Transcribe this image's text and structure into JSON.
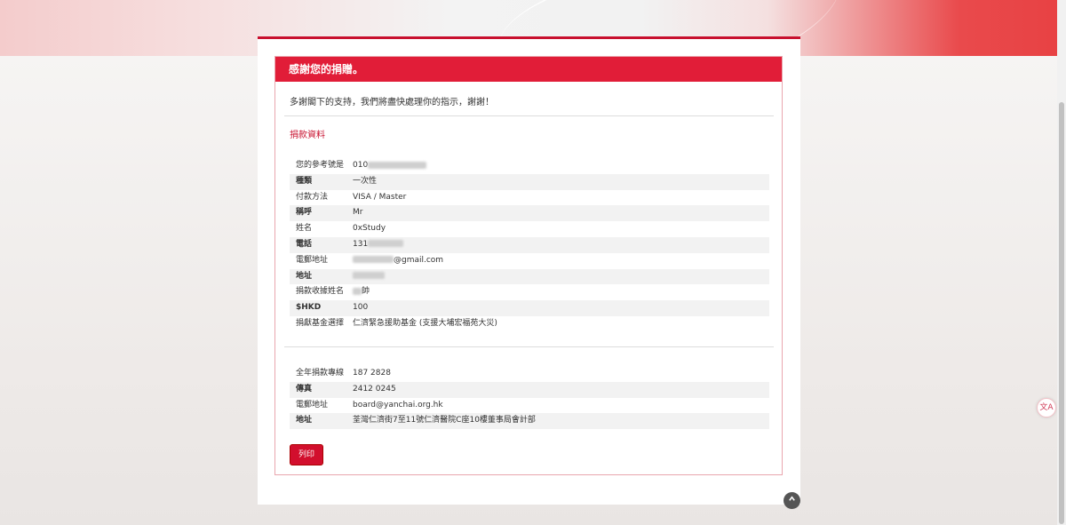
{
  "header": {
    "title": "感謝您的捐贈。"
  },
  "intro": "多謝閣下的支持，我們將盡快處理你的指示，謝謝！",
  "section_title": "捐款資料",
  "donation_rows": [
    {
      "label": "您的參考號是",
      "value": "010"
    },
    {
      "label": "種類",
      "value": "一次性"
    },
    {
      "label": "付款方法",
      "value": "VISA / Master"
    },
    {
      "label": "稱呼",
      "value": "Mr"
    },
    {
      "label": "姓名",
      "value": "0xStudy"
    },
    {
      "label": "電話",
      "value": "131"
    },
    {
      "label": "電郵地址",
      "value": "@gmail.com"
    },
    {
      "label": "地址",
      "value": ""
    },
    {
      "label": "捐款收據姓名",
      "value": "帥"
    },
    {
      "label": "$HKD",
      "value": "100"
    },
    {
      "label": "捐獻基金選擇",
      "value": "仁濟緊急援助基金 (支援大埔宏福苑大災)"
    }
  ],
  "contact_rows": [
    {
      "label": "全年捐款專線",
      "value": "187 2828"
    },
    {
      "label": "傳真",
      "value": "2412 0245"
    },
    {
      "label": "電郵地址",
      "value": "board@yanchai.org.hk"
    },
    {
      "label": "地址",
      "value": "荃灣仁濟街7至11號仁濟醫院C座10樓董事局會計部"
    }
  ],
  "print_label": "列印",
  "back_to_top_icon": "chevron-up-icon",
  "float_widget_label": "文A",
  "colors": {
    "accent": "#e11d38",
    "button": "#d20f2d"
  }
}
